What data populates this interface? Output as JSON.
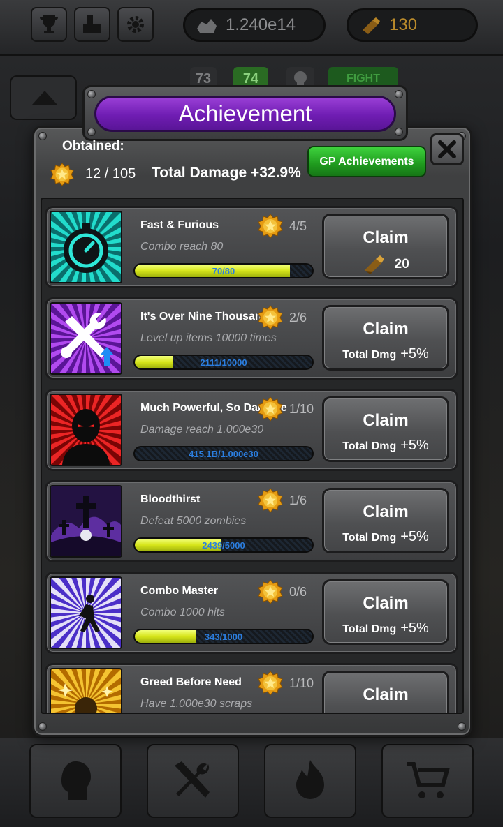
{
  "topbar": {
    "scraps_value": "1.240e14",
    "gold_value": "130",
    "buttons": [
      "trophy-icon",
      "blocks-icon",
      "gear-icon"
    ]
  },
  "waves": {
    "prev": "73",
    "current": "74",
    "fight_label": "FIGHT"
  },
  "dialog": {
    "title": "Achievement",
    "obtained_label": "Obtained:",
    "count": "12 / 105",
    "total_damage": "Total Damage +32.9%",
    "gp_button": "GP Achievements"
  },
  "achievements": [
    {
      "name": "Fast & Furious",
      "desc": "Combo reach 80",
      "tier": "4/5",
      "progress_text": "70/80",
      "progress": 0.875,
      "claim": "Claim",
      "reward_amount": "20",
      "reward_type": "bolts",
      "icon": "stopwatch-icon",
      "theme": "#15d6c8"
    },
    {
      "name": "It's Over Nine Thousand!",
      "desc": "Level up items 10000 times",
      "tier": "2/6",
      "progress_text": "2111/10000",
      "progress": 0.211,
      "claim": "Claim",
      "reward_label": "Total Dmg",
      "reward_pct": "+5%",
      "reward_type": "damage",
      "icon": "tools-upgrade-icon",
      "theme": "#9a33d8"
    },
    {
      "name": "Much Powerful, So Damage",
      "desc": "Damage reach 1.000e30",
      "tier": "1/10",
      "progress_text": "415.1B/1.000e30",
      "progress": 0.0,
      "claim": "Claim",
      "reward_label": "Total Dmg",
      "reward_pct": "+5%",
      "reward_type": "damage",
      "icon": "angry-silhouette-icon",
      "theme": "#d81a1a"
    },
    {
      "name": "Bloodthirst",
      "desc": "Defeat 5000 zombies",
      "tier": "1/6",
      "progress_text": "2439/5000",
      "progress": 0.488,
      "claim": "Claim",
      "reward_label": "Total Dmg",
      "reward_pct": "+5%",
      "reward_type": "damage",
      "icon": "graveyard-icon",
      "theme": "#4a2a7a"
    },
    {
      "name": "Combo Master",
      "desc": "Combo 1000 hits",
      "tier": "0/6",
      "progress_text": "343/1000",
      "progress": 0.343,
      "claim": "Claim",
      "reward_label": "Total Dmg",
      "reward_pct": "+5%",
      "reward_type": "damage",
      "icon": "dancer-icon",
      "theme": "#6a4bdc"
    },
    {
      "name": "Greed Before Need",
      "desc": "Have 1.000e30 scraps",
      "tier": "1/10",
      "progress_text": "",
      "progress": 0.1,
      "claim": "Claim",
      "reward_type": "damage",
      "icon": "scrap-pile-icon",
      "theme": "#e8a20f"
    }
  ],
  "bottom_nav": [
    "hero-icon",
    "tools-icon",
    "fire-icon",
    "cart-icon"
  ]
}
